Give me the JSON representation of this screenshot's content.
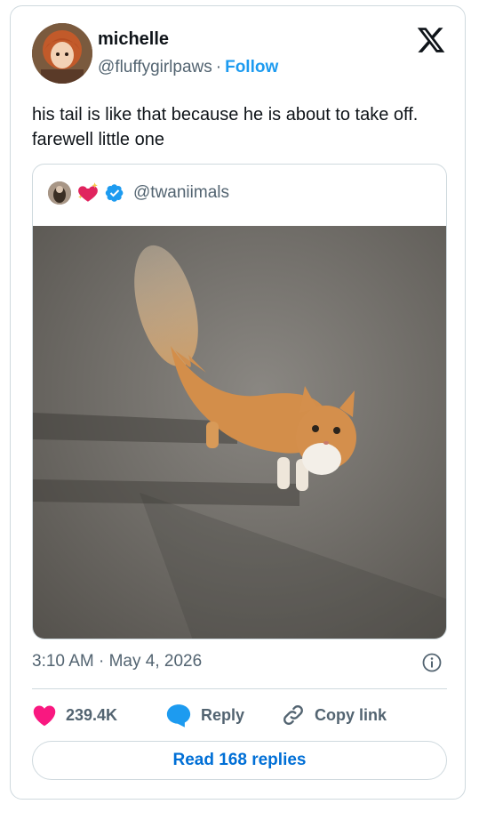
{
  "author": {
    "name": "michelle",
    "handle": "@fluffygirlpaws",
    "separator": "·",
    "follow_label": "Follow"
  },
  "tweet": {
    "text": "his tail is like that because he is about to take off. farewell little one",
    "timestamp": "3:10 AM · May 4, 2026"
  },
  "quoted": {
    "handle": "@twaniimals"
  },
  "actions": {
    "likes": "239.4K",
    "reply_label": "Reply",
    "copy_label": "Copy link"
  },
  "read_replies_label": "Read 168 replies",
  "icons": [
    "x-logo-icon",
    "info-icon",
    "heart-icon",
    "reply-icon",
    "link-icon",
    "verified-badge-icon",
    "sparkling-heart-icon"
  ],
  "colors": {
    "accent": "#1d9bf0",
    "link": "#006fd6",
    "heart": "#f91880",
    "muted": "#536471"
  }
}
